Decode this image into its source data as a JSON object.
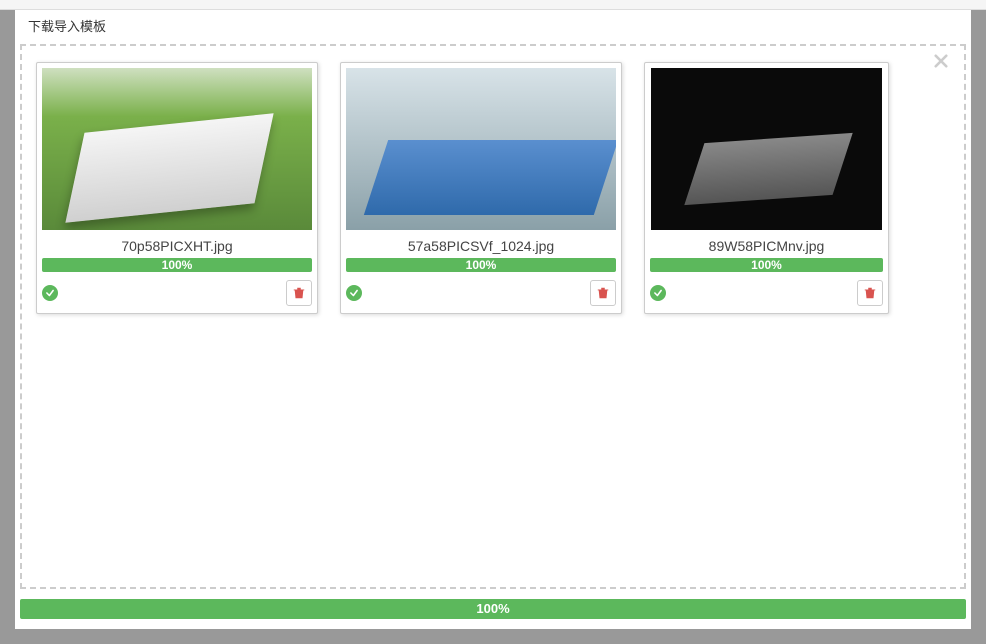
{
  "header": {
    "download_template_label": "下载导入模板"
  },
  "files": [
    {
      "name": "70p58PICXHT.jpg",
      "progress": "100%"
    },
    {
      "name": "57a58PICSVf_1024.jpg",
      "progress": "100%"
    },
    {
      "name": "89W58PICMnv.jpg",
      "progress": "100%"
    }
  ],
  "overall": {
    "progress": "100%"
  }
}
